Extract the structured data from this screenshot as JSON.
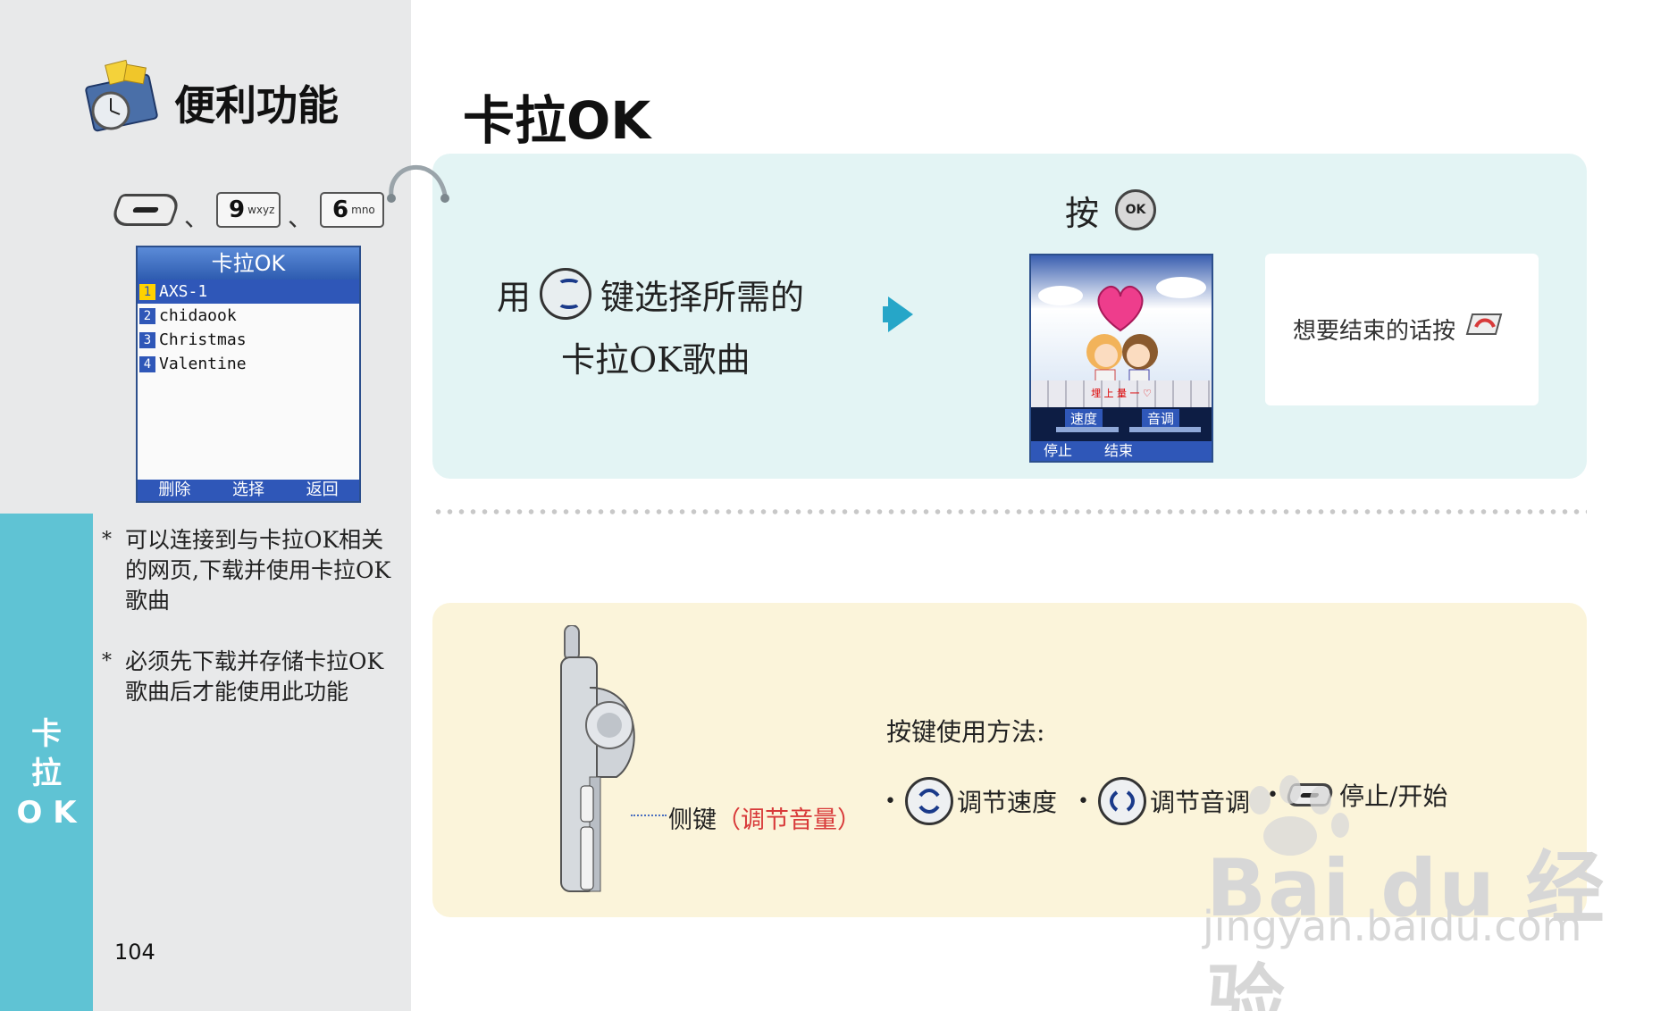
{
  "section": {
    "title": "便利功能",
    "icon": "toolbox-clock-icon"
  },
  "side_tab": {
    "label": "卡\n拉\nO K"
  },
  "key_sequence": {
    "separator": "、",
    "keys": [
      {
        "icon": "soft-key-icon"
      },
      {
        "digit": "9",
        "letters": "wxyz"
      },
      {
        "digit": "6",
        "letters": "mno"
      }
    ]
  },
  "phone_menu": {
    "header": "卡拉OK",
    "items": [
      {
        "num": "1",
        "label": "AXS-1",
        "selected": true
      },
      {
        "num": "2",
        "label": "chidaook",
        "selected": false
      },
      {
        "num": "3",
        "label": "Christmas",
        "selected": false
      },
      {
        "num": "4",
        "label": "Valentine",
        "selected": false
      }
    ],
    "footer": [
      "删除",
      "选择",
      "返回"
    ]
  },
  "notes": [
    "可以连接到与卡拉OK相关的网页,下载并使用卡拉OK歌曲",
    "必须先下载并存储卡拉OK歌曲后才能使用此功能"
  ],
  "note_marker": "*",
  "page_number": "104",
  "main_title": "卡拉OK",
  "step1": {
    "prefix": "用",
    "suffix": "键选择所需的",
    "line2": "卡拉OK歌曲"
  },
  "step2": {
    "press": "按",
    "ok_label": "OK"
  },
  "karaoke_screen": {
    "lyric": "埋 上 量 一 ♡",
    "speed_label": "速度",
    "tone_label": "音调",
    "footer_left": "停止",
    "footer_right": "结束"
  },
  "end_instruction": "想要结束的话按",
  "usage": {
    "side_key_label": "侧键",
    "side_key_note": "（调节音量）",
    "title": "按键使用方法:",
    "bullet": "•",
    "items": [
      {
        "icon": "up-down-nav-icon",
        "label": "调节速度"
      },
      {
        "icon": "left-right-nav-icon",
        "label": "调节音调"
      },
      {
        "icon": "soft-key-icon",
        "label": "停止/开始"
      }
    ]
  },
  "watermark": {
    "brand": "Bai du 经验",
    "url": "jingyan.baidu.com"
  },
  "colors": {
    "side_tab": "#5fc3d4",
    "left_bg": "#e8e9ea",
    "panel_top": "#e3f4f4",
    "panel_bottom": "#fbf4da",
    "accent_blue": "#2f57b8",
    "arrow": "#26a6c8",
    "note_red": "#d83a3a"
  }
}
